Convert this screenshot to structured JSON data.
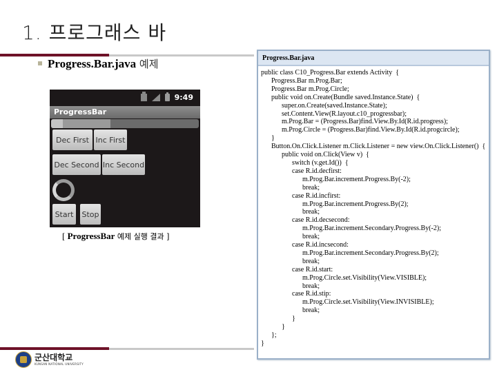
{
  "slide": {
    "title": "1. 프로그래스 바",
    "bullet_bold": "Progress.Bar.java",
    "bullet_normal": " 예제",
    "caption_open": "[ ",
    "caption_bold": "ProgressBar",
    "caption_normal": " 예제 실행 결과 ]",
    "accent_color": "#6e1228"
  },
  "phone": {
    "clock": "9:49",
    "status_icons": [
      "sync-icon",
      "signal-icon",
      "battery-icon"
    ],
    "app_title": "ProgressBar",
    "progress_primary_pct": 8,
    "progress_secondary_pct": 40,
    "buttons": {
      "dec_first": "Dec First",
      "inc_first": "Inc First",
      "dec_second": "Dec Second",
      "inc_second": "Inc Second",
      "start": "Start",
      "stop": "Stop"
    }
  },
  "code": {
    "filename": "Progress.Bar.java",
    "lines": [
      "public class C10_Progress.Bar extends Activity  {",
      "      Progress.Bar m.Prog.Bar;",
      "      Progress.Bar m.Prog.Circle;",
      "      public void on.Create(Bundle saved.Instance.State)  {",
      "            super.on.Create(saved.Instance.State);",
      "            set.Content.View(R.layout.c10_progressbar);",
      "",
      "            m.Prog.Bar = (Progress.Bar)find.View.By.Id(R.id.progress);",
      "            m.Prog.Circle = (Progress.Bar)find.View.By.Id(R.id.progcircle);",
      "      }",
      "      Button.On.Click.Listener m.Click.Listener = new view.On.Click.Listener()  {",
      "            public void on.Click(View v)  {",
      "                  switch (v.get.Id())  {",
      "                  case R.id.decfirst:",
      "                        m.Prog.Bar.increment.Progress.By(-2);",
      "                        break;",
      "                  case R.id.incfirst:",
      "                        m.Prog.Bar.increment.Progress.By(2);",
      "                        break;",
      "                  case R.id.decsecond:",
      "                        m.Prog.Bar.increment.Secondary.Progress.By(-2);",
      "                        break;",
      "                  case R.id.incsecond:",
      "                        m.Prog.Bar.increment.Secondary.Progress.By(2);",
      "                        break;",
      "                  case R.id.start:",
      "                        m.Prog.Circle.set.Visibility(View.VISIBLE);",
      "                        break;",
      "                  case R.id.stip:",
      "                        m.Prog.Circle.set.Visibility(View.INVISIBLE);",
      "                        break;",
      "                  }",
      "            }",
      "      };",
      "}"
    ]
  },
  "footer": {
    "logo_kr": "군산대학교",
    "logo_en": "KUNSAN NATIONAL UNIVERSITY"
  }
}
